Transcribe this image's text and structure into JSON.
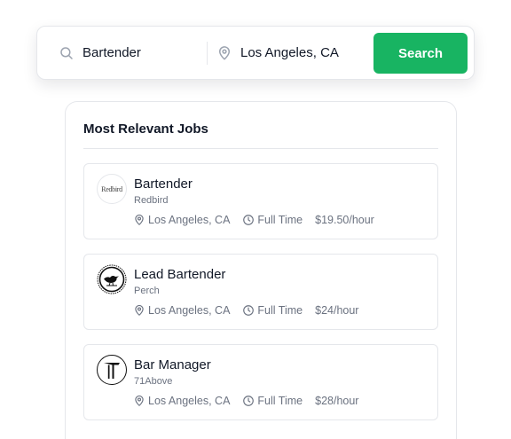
{
  "search": {
    "query_value": "Bartender",
    "location_value": "Los Angeles, CA",
    "button_label": "Search"
  },
  "panel": {
    "title": "Most Relevant Jobs"
  },
  "jobs": [
    {
      "title": "Bartender",
      "company": "Redbird",
      "logo_text": "Redbird",
      "location": "Los Angeles, CA",
      "type": "Full Time",
      "pay": "$19.50/hour"
    },
    {
      "title": "Lead Bartender",
      "company": "Perch",
      "location": "Los Angeles, CA",
      "type": "Full Time",
      "pay": "$24/hour"
    },
    {
      "title": "Bar Manager",
      "company": "71Above",
      "location": "Los Angeles, CA",
      "type": "Full Time",
      "pay": "$28/hour"
    }
  ],
  "colors": {
    "accent": "#18b462",
    "muted_text": "#6b7280",
    "border": "#e5e7eb"
  },
  "icons": {
    "query": "search-icon",
    "location": "map-pin-icon",
    "job_location": "map-pin-icon",
    "job_type": "clock-icon"
  }
}
